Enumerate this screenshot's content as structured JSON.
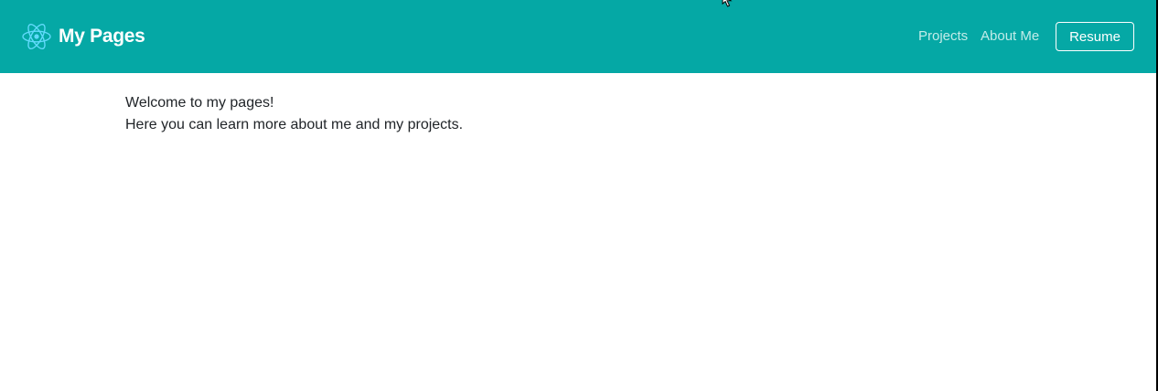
{
  "navbar": {
    "brand_text": "My Pages",
    "brand_icon": "react-atom-icon",
    "links": {
      "projects": "Projects",
      "about": "About Me"
    },
    "resume_label": "Resume"
  },
  "content": {
    "line1": "Welcome to my pages!",
    "line2": "Here you can learn more about me and my projects."
  },
  "colors": {
    "navbar_bg": "#05a8a5",
    "brand_icon": "#61dafb",
    "nav_link": "#c2ece9",
    "text": "#212529"
  }
}
